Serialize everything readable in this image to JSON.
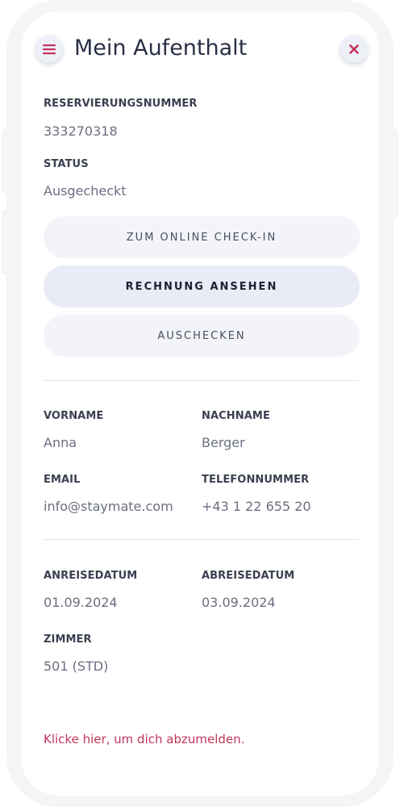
{
  "colors": {
    "accent": "#c2365d",
    "frame": "#f5f5f7",
    "button_bg": "#f3f4f9",
    "primary_button_bg": "#e9ebf6",
    "title": "#2a2f45"
  },
  "header": {
    "menu_icon": "hamburger-menu-icon",
    "title": "Mein Aufenthalt",
    "close_icon": "close-icon"
  },
  "reservation": {
    "number_label": "RESERVIERUNGSNUMMER",
    "number_value": "333270318",
    "status_label": "STATUS",
    "status_value": "Ausgecheckt"
  },
  "actions": {
    "checkin": "ZUM ONLINE CHECK-IN",
    "invoice": "RECHNUNG ANSEHEN",
    "checkout": "AUSCHECKEN"
  },
  "guest": {
    "firstname_label": "VORNAME",
    "firstname_value": "Anna",
    "lastname_label": "NACHNAME",
    "lastname_value": "Berger",
    "email_label": "EMAIL",
    "email_value": "info@staymate.com",
    "phone_label": "TELEFONNUMMER",
    "phone_value": "+43 1 22 655 20"
  },
  "stay": {
    "arrival_label": "ANREISEDATUM",
    "arrival_value": "01.09.2024",
    "departure_label": "ABREISEDATUM",
    "departure_value": "03.09.2024",
    "room_label": "ZIMMER",
    "room_value": "501 (STD)"
  },
  "footer": {
    "logout_link": "Klicke hier, um dich abzumelden."
  }
}
